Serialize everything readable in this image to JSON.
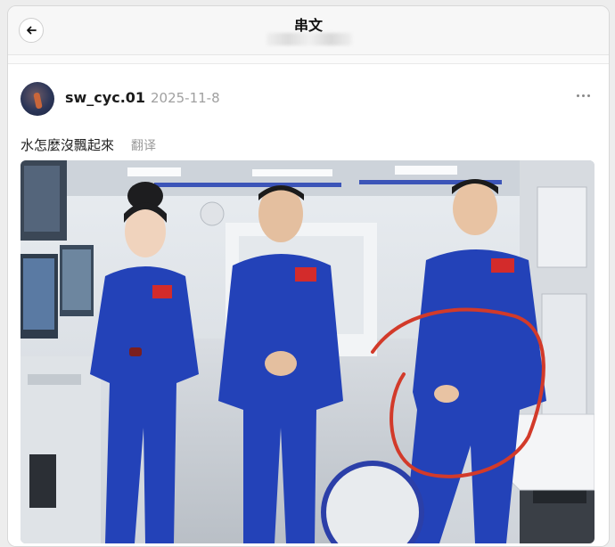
{
  "header": {
    "title": "串文",
    "back_icon": "arrow-left-icon"
  },
  "post": {
    "username": "sw_cyc.01",
    "date": "2025-11-8",
    "text": "水怎麼沒飄起來",
    "translate_label": "翻译",
    "more_icon": "more-dots-icon"
  },
  "photo": {
    "subject": "three astronauts in blue flight suits inside a space station module, a red circle highlighting a glass of water on a table",
    "highlight_color": "#d23a2a",
    "suit_color": "#2342b8"
  }
}
